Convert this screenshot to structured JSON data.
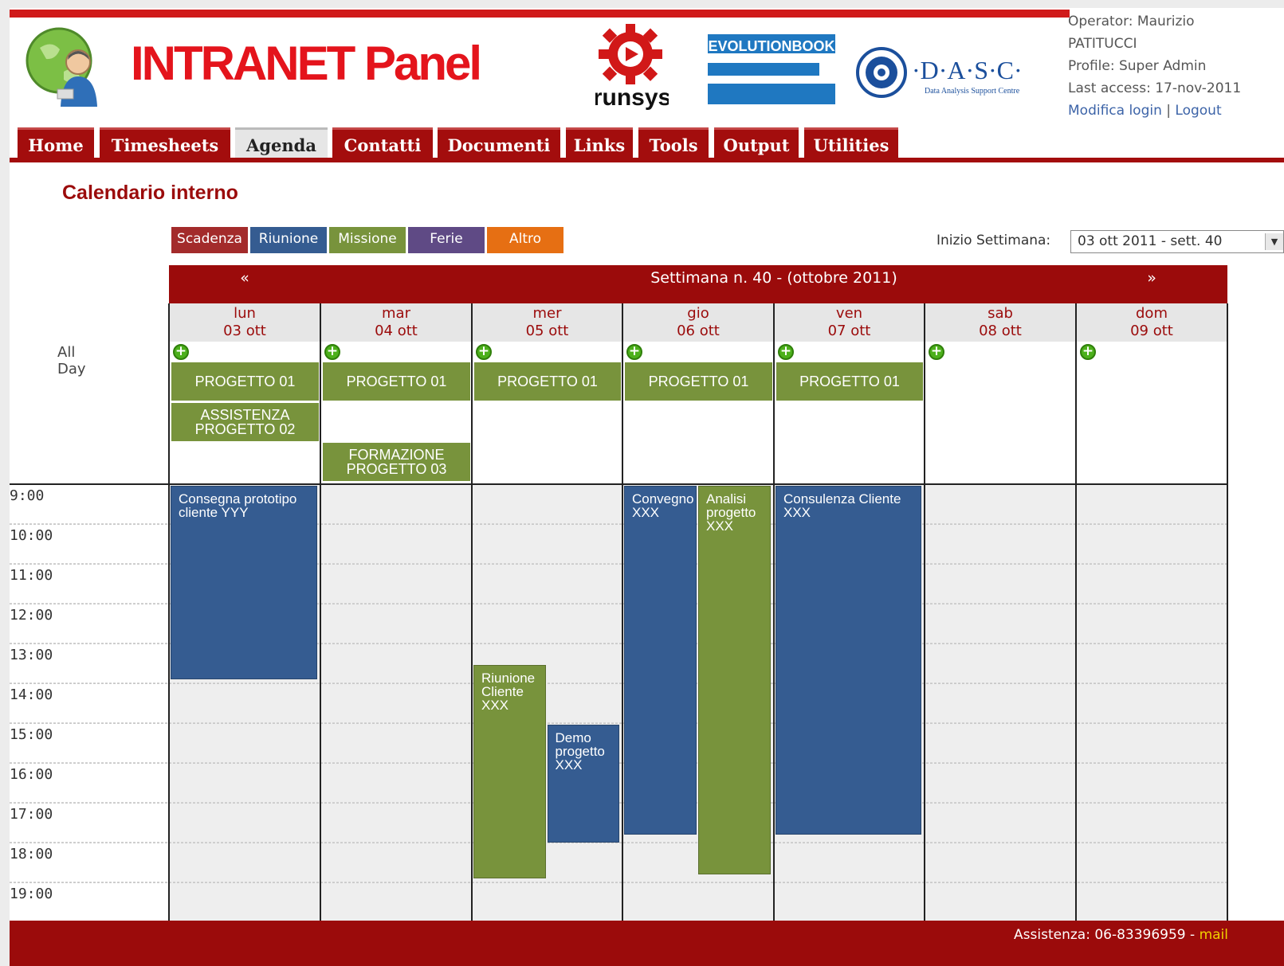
{
  "header": {
    "brand": "INTRANET Panel",
    "logos": [
      "globe-user-logo",
      "runsys-logo",
      "evolutionbook-logo",
      "dasc-logo"
    ],
    "runsys_text": "runsys",
    "eb_text": "EVOLUTIONBOOK",
    "dasc_text": "·D·A·S·C·",
    "dasc_sub": "Data Analysis Support Centre"
  },
  "user": {
    "operator_line1": "Operator: Maurizio",
    "operator_line2": "PATITUCCI",
    "profile": "Profile: Super Admin",
    "last_access": "Last access: 17-nov-2011",
    "modifica_login": "Modifica login",
    "separator": "|",
    "logout": "Logout"
  },
  "tabs": [
    {
      "label": "Home",
      "active": false
    },
    {
      "label": "Timesheets",
      "active": false
    },
    {
      "label": "Agenda",
      "active": true
    },
    {
      "label": "Contatti",
      "active": false
    },
    {
      "label": "Documenti",
      "active": false
    },
    {
      "label": "Links",
      "active": false
    },
    {
      "label": "Tools",
      "active": false
    },
    {
      "label": "Output",
      "active": false
    },
    {
      "label": "Utilities",
      "active": false
    }
  ],
  "page_title": "Calendario interno",
  "legend": [
    {
      "label": "Scadenza",
      "color": "#a32b2b"
    },
    {
      "label": "Riunione",
      "color": "#355c91"
    },
    {
      "label": "Missione",
      "color": "#78933c"
    },
    {
      "label": "Ferie",
      "color": "#5f4a85"
    },
    {
      "label": "Altro",
      "color": "#e66f13"
    }
  ],
  "week_selector": {
    "label": "Inizio Settimana:",
    "value": "03 ott 2011 - sett. 40"
  },
  "calendar": {
    "prev": "«",
    "next": "»",
    "week_title": "Settimana n. 40 - (ottobre 2011)",
    "all_day_label": "All Day",
    "days": [
      {
        "name": "lun",
        "date": "03 ott"
      },
      {
        "name": "mar",
        "date": "04 ott"
      },
      {
        "name": "mer",
        "date": "05 ott"
      },
      {
        "name": "gio",
        "date": "06 ott"
      },
      {
        "name": "ven",
        "date": "07 ott"
      },
      {
        "name": "sab",
        "date": "08 ott"
      },
      {
        "name": "dom",
        "date": "09 ott"
      }
    ],
    "hours": [
      "9:00",
      "10:00",
      "11:00",
      "12:00",
      "13:00",
      "14:00",
      "15:00",
      "16:00",
      "17:00",
      "18:00",
      "19:00"
    ],
    "all_day_events": [
      {
        "day": 0,
        "row": 0,
        "text": "PROGETTO 01",
        "type": "Missione"
      },
      {
        "day": 0,
        "row": 1,
        "text": "ASSISTENZA PROGETTO 02",
        "type": "Missione"
      },
      {
        "day": 1,
        "row": 0,
        "text": "PROGETTO 01",
        "type": "Missione"
      },
      {
        "day": 1,
        "row": 2,
        "text": "FORMAZIONE PROGETTO 03",
        "type": "Missione"
      },
      {
        "day": 2,
        "row": 0,
        "text": "PROGETTO 01",
        "type": "Missione"
      },
      {
        "day": 3,
        "row": 0,
        "text": "PROGETTO 01",
        "type": "Missione"
      },
      {
        "day": 4,
        "row": 0,
        "text": "PROGETTO 01",
        "type": "Missione"
      }
    ],
    "timed_events": [
      {
        "day": 0,
        "text": "Consegna prototipo cliente YYY",
        "start": 9.0,
        "end": 13.85,
        "col": 0,
        "cols": 1,
        "type": "Riunione"
      },
      {
        "day": 2,
        "text": "Riunione Cliente XXX",
        "start": 13.5,
        "end": 18.85,
        "col": 0,
        "cols": 2,
        "type": "Missione"
      },
      {
        "day": 2,
        "text": "Demo progetto XXX",
        "start": 15.0,
        "end": 17.95,
        "col": 1,
        "cols": 2,
        "type": "Riunione"
      },
      {
        "day": 3,
        "text": "Convegno XXX",
        "start": 9.0,
        "end": 17.75,
        "col": 0,
        "cols": 2,
        "type": "Riunione"
      },
      {
        "day": 3,
        "text": "Analisi progetto XXX",
        "start": 9.0,
        "end": 18.75,
        "col": 1,
        "cols": 2,
        "type": "Missione"
      },
      {
        "day": 4,
        "text": "Consulenza Cliente XXX",
        "start": 9.0,
        "end": 17.75,
        "col": 0,
        "cols": 1,
        "type": "Riunione"
      }
    ]
  },
  "footer": {
    "text": "Assistenza: 06-83396959 - ",
    "mail": "mail"
  }
}
